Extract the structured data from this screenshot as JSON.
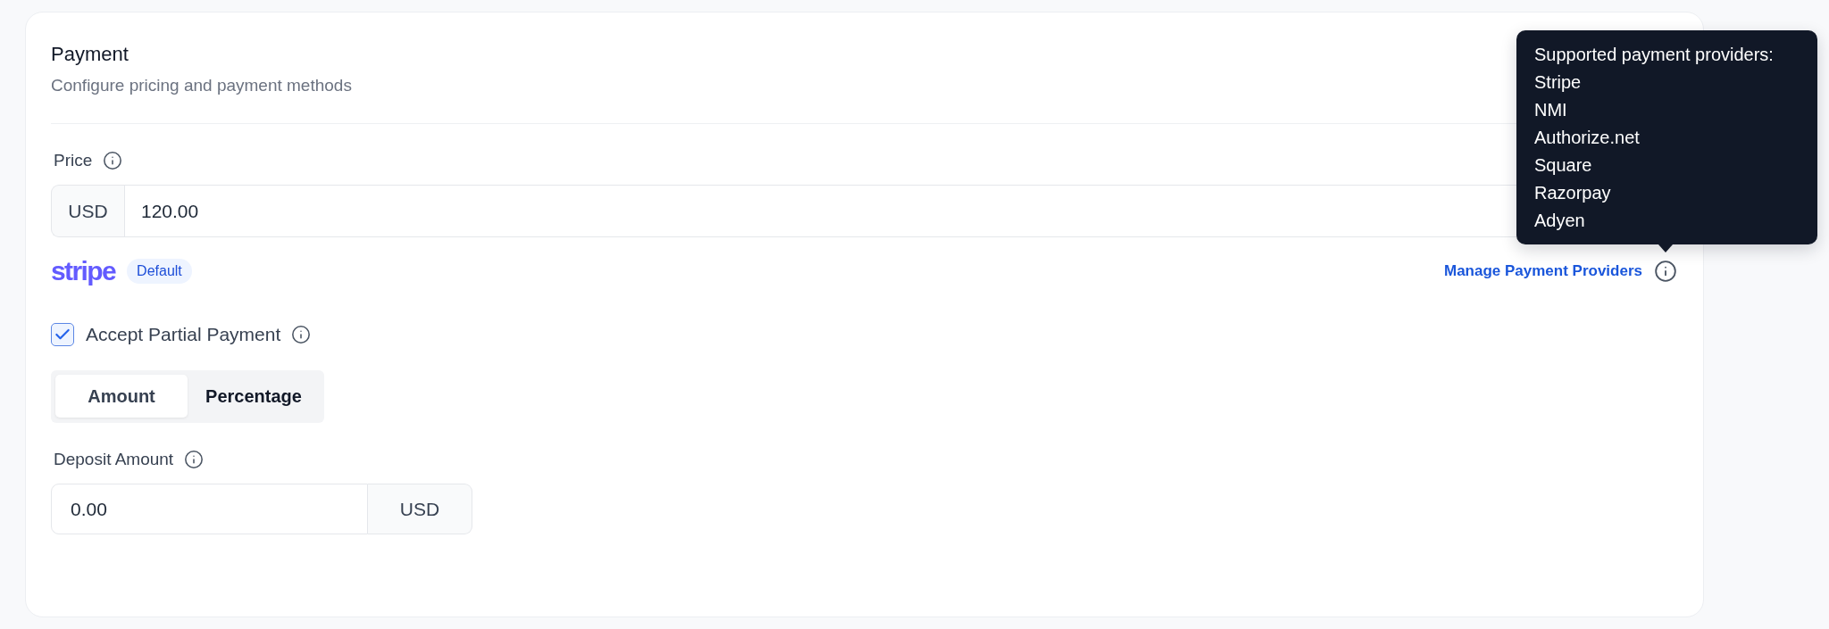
{
  "card": {
    "title": "Payment",
    "subtitle": "Configure pricing and payment methods"
  },
  "price": {
    "label": "Price",
    "currency": "USD",
    "value": "120.00"
  },
  "provider": {
    "logo": "stripe",
    "badge": "Default",
    "manage_link": "Manage Payment Providers"
  },
  "tooltip": {
    "heading": "Supported payment providers:",
    "items": [
      "Stripe",
      "NMI",
      "Authorize.net",
      "Square",
      "Razorpay",
      "Adyen"
    ]
  },
  "partial_payment": {
    "label": "Accept Partial Payment",
    "checked": true,
    "modes": [
      {
        "label": "Amount",
        "selected": true
      },
      {
        "label": "Percentage",
        "selected": false
      }
    ]
  },
  "deposit": {
    "label": "Deposit Amount",
    "value": "0.00",
    "currency": "USD"
  }
}
